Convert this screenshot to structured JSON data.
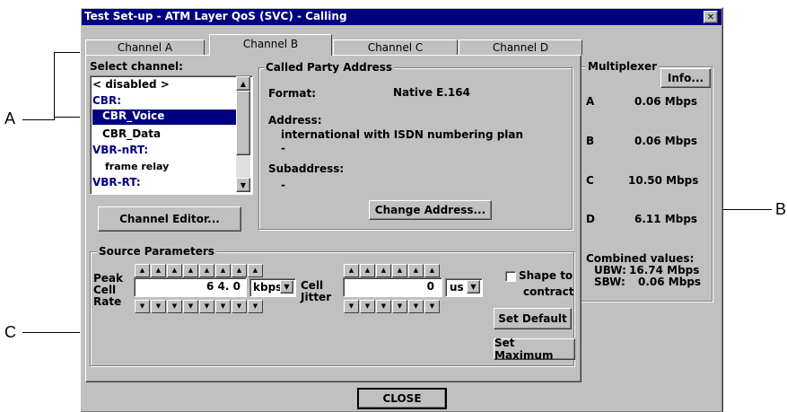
{
  "window": {
    "title": "Test Set-up - ATM Layer QoS (SVC) - Calling",
    "close_glyph": "✕"
  },
  "tabs": [
    {
      "label": "Channel A"
    },
    {
      "label": "Channel B",
      "active": true
    },
    {
      "label": "Channel C"
    },
    {
      "label": "Channel D"
    }
  ],
  "select_channel": {
    "label": "Select channel:",
    "items": [
      {
        "text": "< disabled >",
        "style": "normal-bold"
      },
      {
        "text": "CBR:",
        "style": "category"
      },
      {
        "text": "CBR_Voice",
        "style": "selected"
      },
      {
        "text": "CBR_Data",
        "style": "item"
      },
      {
        "text": "VBR-nRT:",
        "style": "category"
      },
      {
        "text": "frame relay",
        "style": "item-small"
      },
      {
        "text": "VBR-RT:",
        "style": "category"
      }
    ],
    "channel_editor_button": "Channel Editor..."
  },
  "called_party": {
    "legend": "Called Party Address",
    "format_label": "Format:",
    "format_value": "Native E.164",
    "address_label": "Address:",
    "address_value": "international with ISDN numbering plan",
    "address_dash": "-",
    "subaddress_label": "Subaddress:",
    "subaddress_dash": "-",
    "change_address_button": "Change Address..."
  },
  "source_parameters": {
    "legend": "Source Parameters",
    "peak_label": [
      "Peak",
      "Cell",
      "Rate"
    ],
    "peak_value": "6 4. 0",
    "peak_unit": "kbps",
    "jitter_label": [
      "Cell",
      "Jitter"
    ],
    "jitter_value": "0",
    "jitter_unit": "us",
    "shape_checkbox_label": [
      "Shape to",
      "contract"
    ],
    "set_default_button": "Set Default",
    "set_maximum_button": "Set Maximum"
  },
  "multiplexer": {
    "legend": "Multiplexer",
    "info_button": "Info...",
    "rows": [
      {
        "channel": "A",
        "rate": "0.06 Mbps"
      },
      {
        "channel": "B",
        "rate": "0.06 Mbps"
      },
      {
        "channel": "C",
        "rate": "10.50 Mbps"
      },
      {
        "channel": "D",
        "rate": "6.11 Mbps"
      }
    ],
    "combined_label": "Combined values:",
    "ubw_label": "UBW:",
    "ubw_value": "16.74 Mbps",
    "sbw_label": "SBW:",
    "sbw_value": "0.06 Mbps"
  },
  "close_button": "CLOSE",
  "callouts": {
    "a": "A",
    "b": "B",
    "c": "C"
  },
  "icons": {
    "spin_up": "▲",
    "spin_down": "▼",
    "scroll_up": "▲",
    "scroll_down": "▼",
    "dropdown": "▼"
  }
}
